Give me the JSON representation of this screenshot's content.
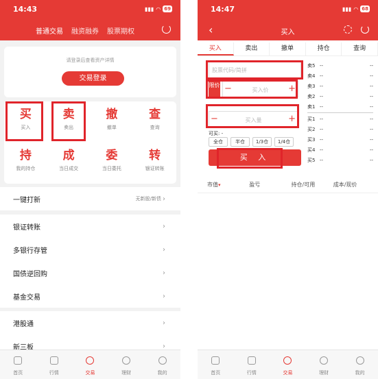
{
  "left": {
    "status": {
      "time": "14:43",
      "battery": "69"
    },
    "top_tabs": [
      "普通交易",
      "融资融券",
      "股票期权"
    ],
    "login_hint": "请登录后查看资产详情",
    "login_button": "交易登录",
    "actions": [
      {
        "glyph": "买",
        "label": "买入"
      },
      {
        "glyph": "卖",
        "label": "卖出"
      },
      {
        "glyph": "撤",
        "label": "撤单"
      },
      {
        "glyph": "查",
        "label": "查询"
      },
      {
        "glyph": "持",
        "label": "我的持仓"
      },
      {
        "glyph": "成",
        "label": "当日成交"
      },
      {
        "glyph": "委",
        "label": "当日委托"
      },
      {
        "glyph": "转",
        "label": "银证转账"
      }
    ],
    "ipo_row": {
      "label": "一键打新",
      "right": "无新股/新债"
    },
    "list_rows": [
      "银证转账",
      "多银行存管",
      "国债逆回购",
      "基金交易"
    ],
    "list_rows2": [
      "港股通",
      "新三板"
    ]
  },
  "right": {
    "status": {
      "time": "14:47",
      "battery": "68"
    },
    "title": "买入",
    "tabs": [
      "买入",
      "卖出",
      "撤单",
      "持仓",
      "查询"
    ],
    "code_placeholder": "股票代码/简拼",
    "limit_label": "限价",
    "price_placeholder": "买入价",
    "qty_placeholder": "买入量",
    "available": "可买: -",
    "portions": [
      "全仓",
      "半仓",
      "1/3仓",
      "1/4仓"
    ],
    "buy_button": "买 入",
    "sell_book": [
      {
        "name": "卖5",
        "price": "--",
        "qty": "--"
      },
      {
        "name": "卖4",
        "price": "--",
        "qty": "--"
      },
      {
        "name": "卖3",
        "price": "--",
        "qty": "--"
      },
      {
        "name": "卖2",
        "price": "--",
        "qty": "--"
      },
      {
        "name": "卖1",
        "price": "--",
        "qty": "--"
      }
    ],
    "buy_book": [
      {
        "name": "买1",
        "price": "--",
        "qty": "--"
      },
      {
        "name": "买2",
        "price": "--",
        "qty": "--"
      },
      {
        "name": "买3",
        "price": "--",
        "qty": "--"
      },
      {
        "name": "买4",
        "price": "--",
        "qty": "--"
      },
      {
        "name": "买5",
        "price": "--",
        "qty": "--"
      }
    ],
    "positions_header": [
      "市值",
      "盈亏",
      "持仓/可用",
      "成本/现价"
    ]
  },
  "tabbar": [
    "首页",
    "行情",
    "交易",
    "理财",
    "我的"
  ],
  "accent_color": "#e53a35"
}
